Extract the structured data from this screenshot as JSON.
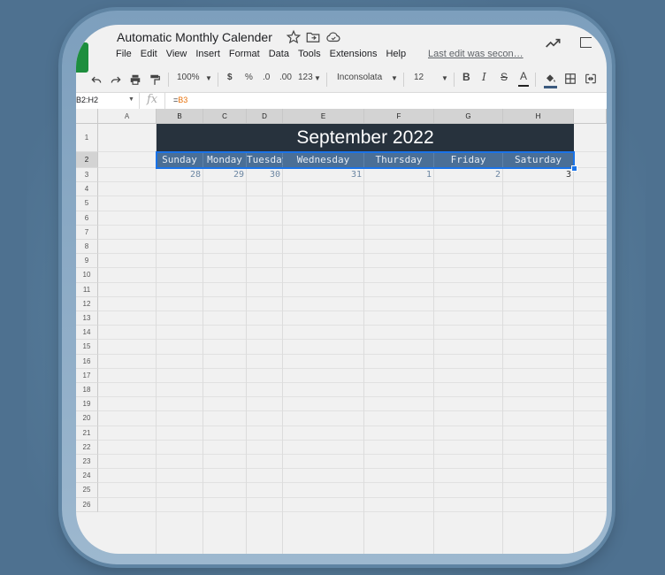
{
  "app": {
    "title": "Automatic Monthly Calender",
    "menu": [
      "File",
      "Edit",
      "View",
      "Insert",
      "Format",
      "Data",
      "Tools",
      "Extensions",
      "Help"
    ],
    "last_edit": "Last edit was secon…"
  },
  "toolbar": {
    "zoom": "100%",
    "currency": "$",
    "percent": "%",
    "dec_decrease": ".0",
    "dec_increase": ".00",
    "more_formats": "123",
    "font": "Inconsolata",
    "font_size": "12",
    "bold": "B",
    "italic": "I",
    "strike": "S",
    "text_color": "A"
  },
  "formula_bar": {
    "name_box": "B2:H2",
    "formula_prefix": "=",
    "formula_ref": "B3"
  },
  "sheet": {
    "columns": [
      "A",
      "B",
      "C",
      "D",
      "E",
      "F",
      "G",
      "H"
    ],
    "rows": [
      "1",
      "2",
      "3",
      "4",
      "5",
      "6",
      "7",
      "8",
      "9",
      "10",
      "11",
      "12",
      "13",
      "14",
      "15",
      "16",
      "17",
      "18",
      "19",
      "20",
      "21",
      "22",
      "23",
      "24",
      "25",
      "26"
    ],
    "month_title": "September 2022",
    "days": [
      "Sunday",
      "Monday",
      "Tuesday",
      "Wednesday",
      "Thursday",
      "Friday",
      "Saturday"
    ],
    "dates": [
      "28",
      "29",
      "30",
      "31",
      "1",
      "2",
      "3"
    ]
  },
  "colors": {
    "banner": "#27323d",
    "day_header": "#4a6f97",
    "selection": "#1a73e8",
    "background": "#4e7190"
  }
}
